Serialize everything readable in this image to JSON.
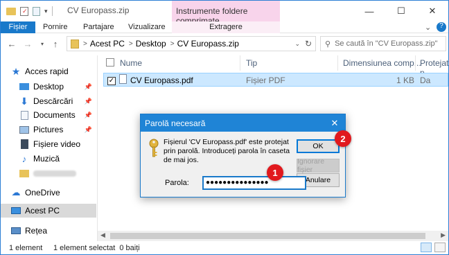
{
  "window": {
    "title": "CV Europass.zip",
    "context_tab_header": "Instrumente foldere comprimate",
    "controls": {
      "minimize": "—",
      "maximize": "☐",
      "close": "✕"
    }
  },
  "ribbon": {
    "tabs": [
      "Fișier",
      "Pornire",
      "Partajare",
      "Vizualizare",
      "Extragere"
    ]
  },
  "address": {
    "breadcrumbs": [
      "Acest PC",
      "Desktop",
      "CV Europass.zip"
    ],
    "search_placeholder": "Se caută în \"CV Europass.zip\""
  },
  "sidebar": {
    "items": [
      {
        "label": "Acces rapid",
        "icon": "star-icon"
      },
      {
        "label": "Desktop",
        "icon": "desktop-folder-icon",
        "pinned": true
      },
      {
        "label": "Descărcări",
        "icon": "download-icon",
        "pinned": true
      },
      {
        "label": "Documents",
        "icon": "documents-icon",
        "pinned": true
      },
      {
        "label": "Pictures",
        "icon": "pictures-icon",
        "pinned": true
      },
      {
        "label": "Fișiere video",
        "icon": "video-icon"
      },
      {
        "label": "Muzică",
        "icon": "music-icon"
      },
      {
        "label": "",
        "icon": "folder-icon"
      },
      {
        "label": "OneDrive",
        "icon": "onedrive-icon"
      },
      {
        "label": "Acest PC",
        "icon": "computer-icon",
        "selected": true
      },
      {
        "label": "Rețea",
        "icon": "network-icon"
      }
    ]
  },
  "filelist": {
    "columns": [
      "Nume",
      "Tip",
      "Dimensiunea comp...",
      "Protejat p"
    ],
    "rows": [
      {
        "name": "CV Europass.pdf",
        "type": "Fișier PDF",
        "size": "1 KB",
        "protected": "Da",
        "checked": true
      }
    ]
  },
  "status": {
    "count": "1 element",
    "selection": "1 element selectat  0 baiți"
  },
  "dialog": {
    "title": "Parolă necesară",
    "message": "Fișierul 'CV Europass.pdf' este protejat prin parolă. Introduceți parola în caseta de mai jos.",
    "password_label": "Parola:",
    "password_value": "●●●●●●●●●●●●●●●",
    "ok_label": "OK",
    "skip_label": "Ignorare fișier",
    "cancel_label": "Anulare"
  },
  "annotations": {
    "step1": "1",
    "step2": "2"
  },
  "colors": {
    "accent": "#1979ca",
    "selection": "#cce8ff",
    "context_tab": "#f8d4eb",
    "badge": "#e1191e"
  }
}
